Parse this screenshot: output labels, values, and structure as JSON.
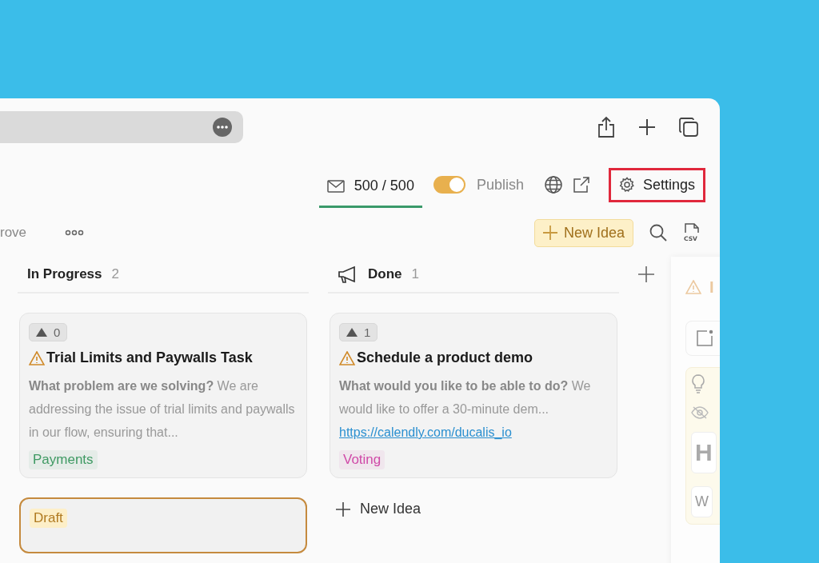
{
  "header": {
    "quota": {
      "value": "500 / 500",
      "selected": true
    },
    "publish": {
      "label": "Publish",
      "on": true
    },
    "settings": {
      "label": "Settings",
      "highlighted": true
    }
  },
  "toolbar": {
    "view_tab": "rove",
    "new_idea": "New Idea",
    "export_label": "CSV"
  },
  "columns": [
    {
      "name": "In Progress",
      "count": "2",
      "kind": "progress",
      "cards": [
        {
          "kind": "idea",
          "votes": "0",
          "title": "Trial Limits and Paywalls Task",
          "text": "**What problem are we solving?** We are addressing the issue of trial limits and paywalls in our flow, ensuring that...",
          "tag": {
            "label": "Payments",
            "color": "#3f9a63"
          }
        },
        {
          "kind": "draft",
          "tag": {
            "label": "Draft",
            "color": "#b07a20"
          }
        }
      ]
    },
    {
      "name": "Done",
      "count": "1",
      "kind": "release",
      "add_label": "New Idea",
      "cards": [
        {
          "kind": "idea",
          "votes": "1",
          "title": "Schedule a product demo",
          "text": "**What would you like to be able to do?** We would like to offer a 30-minute dem...",
          "link": "https://calendly.com/ducalis_io",
          "tag": {
            "label": "Voting",
            "color": "#d04aa8"
          }
        }
      ]
    }
  ],
  "side_panel": {
    "title": "I",
    "fields": [
      "H",
      "W"
    ]
  }
}
